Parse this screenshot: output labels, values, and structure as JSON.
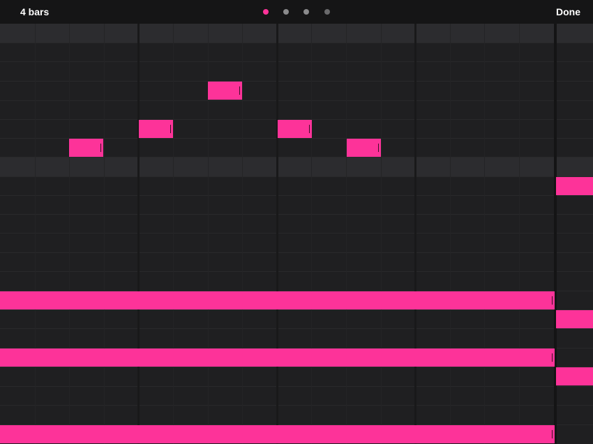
{
  "header": {
    "bars_label": "4 bars",
    "done_label": "Done",
    "page_count": 4,
    "current_page": 1
  },
  "colors": {
    "accent": "#fd3399",
    "background": "#1f1f21",
    "header_row": "#2c2c2f",
    "topbar": "#151516"
  },
  "editor": {
    "lanes": [
      {
        "rows": 6
      },
      {
        "rows": 6
      }
    ],
    "notes": [
      {
        "lane": 1,
        "step": 0,
        "length": 8
      },
      {
        "lane": 3,
        "step": 0,
        "length": 8
      },
      {
        "lane": 4,
        "step": 0,
        "length": 8
      },
      {
        "lane": 5,
        "step": 0,
        "length": 8
      }
    ]
  }
}
